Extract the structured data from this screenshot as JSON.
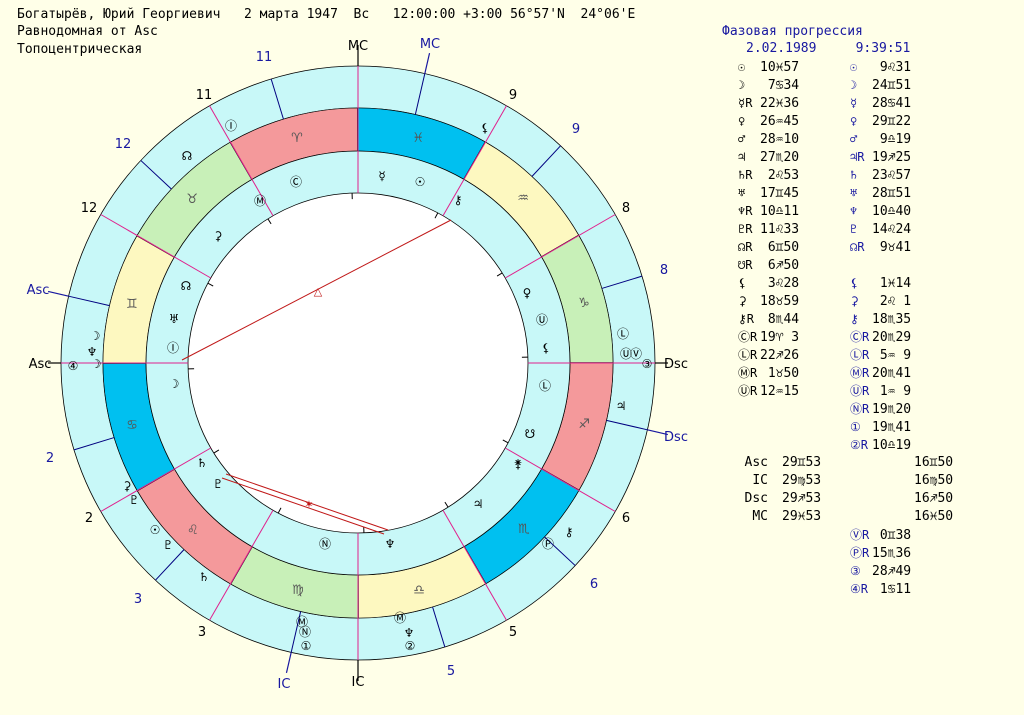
{
  "header": {
    "line1": "Богатырёв, Юрий Георгиевич   2 марта 1947  Вс   12:00:00 +3:00 56°57'N  24°06'E",
    "line2": "Равнодомная от Asc",
    "line3": "Топоцентрическая"
  },
  "progression": {
    "title": "Фазовая прогрессия",
    "date": "2.02.1989     9:39:51"
  },
  "colors": {
    "background": "#ffffe8",
    "ring": "#c8f8f8",
    "fire": "#f4999b",
    "earth": "#c8f0b8",
    "air": "#fdf8c0",
    "water": "#00c0f0",
    "house_line": "#e0208c",
    "aspect": "#c01818",
    "blue_text": "#1818a0"
  },
  "wheel": {
    "mc_inner": "MC",
    "mc_outer": "MC",
    "ic_inner": "IC",
    "ic_outer": "IC",
    "asc_inner": "Asc",
    "asc_outer": "Asc",
    "dsc_inner": "Dsc",
    "dsc_outer": "Dsc",
    "inner_houses": [
      "11",
      "9",
      "8",
      "6",
      "5",
      "3",
      "2",
      "12"
    ],
    "outer_houses": [
      "11",
      "9",
      "8",
      "6",
      "5",
      "3",
      "2",
      "12"
    ],
    "aspect_glyph": "△"
  },
  "natal": [
    {
      "sym": "☉",
      "r": "",
      "pos": "10♓57"
    },
    {
      "sym": "☽",
      "r": "",
      "pos": " 7♋34"
    },
    {
      "sym": "☿",
      "r": "R",
      "pos": "22♓36"
    },
    {
      "sym": "♀",
      "r": "",
      "pos": "26♒45"
    },
    {
      "sym": "♂",
      "r": "",
      "pos": "28♒10"
    },
    {
      "sym": "♃",
      "r": "",
      "pos": "27♏20"
    },
    {
      "sym": "♄",
      "r": "R",
      "pos": " 2♌53"
    },
    {
      "sym": "♅",
      "r": "",
      "pos": "17♊45"
    },
    {
      "sym": "♆",
      "r": "R",
      "pos": "10♎11"
    },
    {
      "sym": "♇",
      "r": "R",
      "pos": "11♌33"
    },
    {
      "sym": "☊",
      "r": "R",
      "pos": " 6♊50"
    },
    {
      "sym": "☋",
      "r": "R",
      "pos": " 6♐50"
    },
    {
      "sym": "⚸",
      "r": "",
      "pos": " 3♌28"
    },
    {
      "sym": "⚳",
      "r": "",
      "pos": "18♉59"
    },
    {
      "sym": "⚷",
      "r": "R",
      "pos": " 8♏44"
    },
    {
      "sym": "Ⓒ",
      "r": "R",
      "pos": "19♈ 3"
    },
    {
      "sym": "Ⓛ",
      "r": "R",
      "pos": "22♐26"
    },
    {
      "sym": "Ⓜ",
      "r": "R",
      "pos": " 1♉50"
    },
    {
      "sym": "Ⓤ",
      "r": "R",
      "pos": "12♒15"
    }
  ],
  "progressed": [
    {
      "sym": "☉",
      "r": "",
      "pos": " 9♌31"
    },
    {
      "sym": "☽",
      "r": "",
      "pos": "24♊51"
    },
    {
      "sym": "☿",
      "r": "",
      "pos": "28♋41"
    },
    {
      "sym": "♀",
      "r": "",
      "pos": "29♊22"
    },
    {
      "sym": "♂",
      "r": "",
      "pos": " 9♎19"
    },
    {
      "sym": "♃",
      "r": "R",
      "pos": "19♐25"
    },
    {
      "sym": "♄",
      "r": "",
      "pos": "23♌57"
    },
    {
      "sym": "♅",
      "r": "",
      "pos": "28♊51"
    },
    {
      "sym": "♆",
      "r": "",
      "pos": "10♎40"
    },
    {
      "sym": "♇",
      "r": "",
      "pos": "14♌24"
    },
    {
      "sym": "☊",
      "r": "R",
      "pos": " 9♉41"
    },
    {
      "sym": "",
      "r": "",
      "pos": ""
    },
    {
      "sym": "⚸",
      "r": "",
      "pos": " 1♓14"
    },
    {
      "sym": "⚳",
      "r": "",
      "pos": " 2♌ 1"
    },
    {
      "sym": "⚷",
      "r": "",
      "pos": "18♏35"
    },
    {
      "sym": "Ⓒ",
      "r": "R",
      "pos": "20♏29"
    },
    {
      "sym": "Ⓛ",
      "r": "R",
      "pos": " 5♒ 9"
    },
    {
      "sym": "Ⓜ",
      "r": "R",
      "pos": "20♏41"
    },
    {
      "sym": "Ⓤ",
      "r": "R",
      "pos": " 1♒ 9"
    },
    {
      "sym": "Ⓝ",
      "r": "R",
      "pos": "19♏20"
    },
    {
      "sym": "①",
      "r": "",
      "pos": "19♏41"
    },
    {
      "sym": "②",
      "r": "R",
      "pos": "10♎19"
    }
  ],
  "angles": [
    {
      "label": "Asc",
      "natal": "29♊53",
      "prog": "16♊50"
    },
    {
      "label": "IC",
      "natal": "29♍53",
      "prog": "16♍50"
    },
    {
      "label": "Dsc",
      "natal": "29♐53",
      "prog": "16♐50"
    },
    {
      "label": "MC",
      "natal": "29♓53",
      "prog": "16♓50"
    }
  ],
  "extra_prog": [
    {
      "sym": "Ⓥ",
      "r": "R",
      "pos": " 0♊38"
    },
    {
      "sym": "Ⓟ",
      "r": "R",
      "pos": "15♏36"
    },
    {
      "sym": "③",
      "r": "",
      "pos": "28♐49"
    },
    {
      "sym": "④",
      "r": "R",
      "pos": " 1♋11"
    }
  ],
  "wheel_glyphs": {
    "sign_glyphs": [
      "♈",
      "♓",
      "♒",
      "♑",
      "♐",
      "♏",
      "♎",
      "♍",
      "♌",
      "♋",
      "♊",
      "♉"
    ]
  }
}
